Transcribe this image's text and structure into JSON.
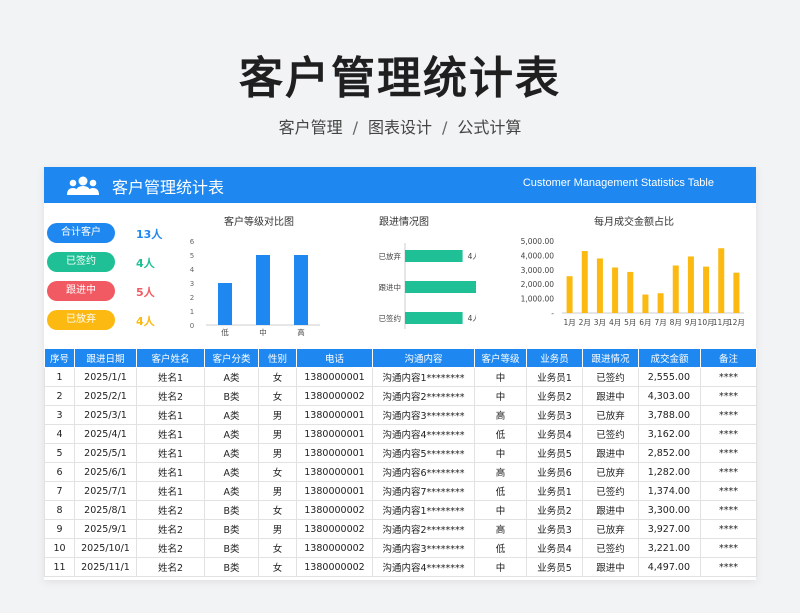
{
  "page": {
    "title": "客户管理统计表",
    "subtitle": [
      "客户管理",
      "图表设计",
      "公式计算"
    ],
    "separator": "/"
  },
  "banner": {
    "title": "客户管理统计表",
    "subtitle_en": "Customer Management Statistics Table",
    "icon": "users-icon",
    "color": "#1e88f0"
  },
  "summary": [
    {
      "label": "合计客户",
      "value": "13人",
      "color": "#1e88f0"
    },
    {
      "label": "已签约",
      "value": "4人",
      "color": "#1fc095"
    },
    {
      "label": "跟进中",
      "value": "5人",
      "color": "#f25a63"
    },
    {
      "label": "已放弃",
      "value": "4人",
      "color": "#fbb911"
    }
  ],
  "chart_data": [
    {
      "type": "bar",
      "title": "客户等级对比图",
      "categories": [
        "低",
        "中",
        "高"
      ],
      "values": [
        3,
        5,
        5
      ],
      "ylim": [
        0,
        6
      ],
      "yticks": [
        "0",
        "1",
        "2",
        "3",
        "4",
        "5",
        "6"
      ],
      "color": "#1e88f0"
    },
    {
      "type": "bar",
      "orientation": "horizontal",
      "title": "跟进情况图",
      "categories": [
        "已放弃",
        "跟进中",
        "已签约"
      ],
      "values": [
        4,
        5,
        4
      ],
      "data_labels": [
        "4人",
        "5人",
        "4人"
      ],
      "color": "#1fc095"
    },
    {
      "type": "bar",
      "title": "每月成交金额占比",
      "categories": [
        "1月",
        "2月",
        "3月",
        "4月",
        "5月",
        "6月",
        "7月",
        "8月",
        "9月",
        "10月",
        "11月",
        "12月"
      ],
      "values": [
        2555,
        4303,
        3788,
        3162,
        2852,
        1282,
        1374,
        3300,
        3927,
        3221,
        4497,
        2800
      ],
      "ylim": [
        0,
        5000
      ],
      "yticks": [
        "-",
        "1,000.00",
        "2,000.00",
        "3,000.00",
        "4,000.00",
        "5,000.00"
      ],
      "color": "#fbb911"
    }
  ],
  "table": {
    "headers": [
      "序号",
      "跟进日期",
      "客户姓名",
      "客户分类",
      "性别",
      "电话",
      "沟通内容",
      "客户等级",
      "业务员",
      "跟进情况",
      "成交金额",
      "备注"
    ],
    "rows": [
      [
        "1",
        "2025/1/1",
        "姓名1",
        "A类",
        "女",
        "1380000001",
        "沟通内容1********",
        "中",
        "业务员1",
        "已签约",
        "2,555.00",
        "****"
      ],
      [
        "2",
        "2025/2/1",
        "姓名2",
        "B类",
        "女",
        "1380000002",
        "沟通内容2********",
        "中",
        "业务员2",
        "跟进中",
        "4,303.00",
        "****"
      ],
      [
        "3",
        "2025/3/1",
        "姓名1",
        "A类",
        "男",
        "1380000001",
        "沟通内容3********",
        "高",
        "业务员3",
        "已放弃",
        "3,788.00",
        "****"
      ],
      [
        "4",
        "2025/4/1",
        "姓名1",
        "A类",
        "男",
        "1380000001",
        "沟通内容4********",
        "低",
        "业务员4",
        "已签约",
        "3,162.00",
        "****"
      ],
      [
        "5",
        "2025/5/1",
        "姓名1",
        "A类",
        "男",
        "1380000001",
        "沟通内容5********",
        "中",
        "业务员5",
        "跟进中",
        "2,852.00",
        "****"
      ],
      [
        "6",
        "2025/6/1",
        "姓名1",
        "A类",
        "女",
        "1380000001",
        "沟通内容6********",
        "高",
        "业务员6",
        "已放弃",
        "1,282.00",
        "****"
      ],
      [
        "7",
        "2025/7/1",
        "姓名1",
        "A类",
        "男",
        "1380000001",
        "沟通内容7********",
        "低",
        "业务员1",
        "已签约",
        "1,374.00",
        "****"
      ],
      [
        "8",
        "2025/8/1",
        "姓名2",
        "B类",
        "女",
        "1380000002",
        "沟通内容1********",
        "中",
        "业务员2",
        "跟进中",
        "3,300.00",
        "****"
      ],
      [
        "9",
        "2025/9/1",
        "姓名2",
        "B类",
        "男",
        "1380000002",
        "沟通内容2********",
        "高",
        "业务员3",
        "已放弃",
        "3,927.00",
        "****"
      ],
      [
        "10",
        "2025/10/1",
        "姓名2",
        "B类",
        "女",
        "1380000002",
        "沟通内容3********",
        "低",
        "业务员4",
        "已签约",
        "3,221.00",
        "****"
      ],
      [
        "11",
        "2025/11/1",
        "姓名2",
        "B类",
        "女",
        "1380000002",
        "沟通内容4********",
        "中",
        "业务员5",
        "跟进中",
        "4,497.00",
        "****"
      ]
    ]
  }
}
